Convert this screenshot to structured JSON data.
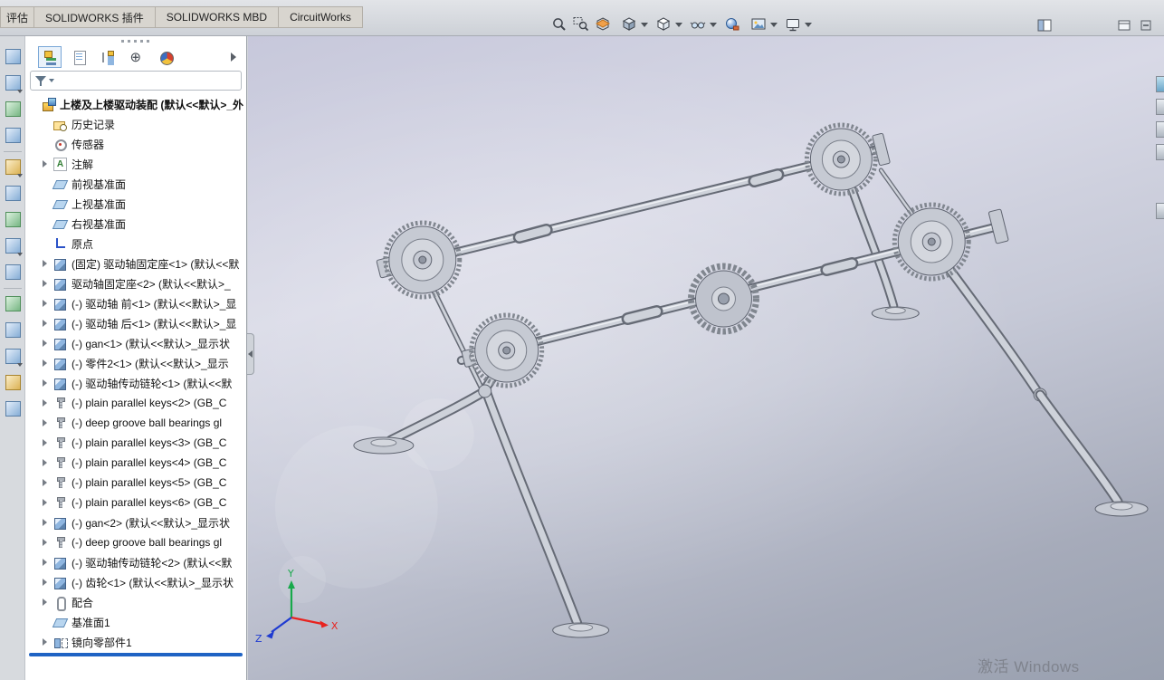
{
  "header": {
    "tabs": [
      "评估",
      "SOLIDWORKS 插件",
      "SOLIDWORKS MBD",
      "CircuitWorks"
    ]
  },
  "tree": {
    "items": [
      {
        "label": "上楼及上楼驱动装配 (默认<<默认>_外",
        "icon": "assembly",
        "indent": 0,
        "arrow": "none",
        "bold": true
      },
      {
        "label": "历史记录",
        "icon": "history",
        "indent": 1,
        "arrow": "none"
      },
      {
        "label": "传感器",
        "icon": "sensor",
        "indent": 1,
        "arrow": "none"
      },
      {
        "label": "注解",
        "icon": "annotation",
        "indent": 1,
        "arrow": "collapsed"
      },
      {
        "label": "前视基准面",
        "icon": "plane",
        "indent": 1,
        "arrow": "none"
      },
      {
        "label": "上视基准面",
        "icon": "plane",
        "indent": 1,
        "arrow": "none"
      },
      {
        "label": "右视基准面",
        "icon": "plane",
        "indent": 1,
        "arrow": "none"
      },
      {
        "label": "原点",
        "icon": "origin",
        "indent": 1,
        "arrow": "none"
      },
      {
        "label": "(固定) 驱动轴固定座<1> (默认<<默",
        "icon": "part",
        "indent": 1,
        "arrow": "collapsed"
      },
      {
        "label": "驱动轴固定座<2> (默认<<默认>_",
        "icon": "part",
        "indent": 1,
        "arrow": "collapsed"
      },
      {
        "label": "(-) 驱动轴 前<1> (默认<<默认>_显",
        "icon": "part",
        "indent": 1,
        "arrow": "collapsed"
      },
      {
        "label": "(-) 驱动轴 后<1> (默认<<默认>_显",
        "icon": "part",
        "indent": 1,
        "arrow": "collapsed"
      },
      {
        "label": "(-) gan<1> (默认<<默认>_显示状",
        "icon": "part",
        "indent": 1,
        "arrow": "collapsed"
      },
      {
        "label": "(-) 零件2<1> (默认<<默认>_显示",
        "icon": "part",
        "indent": 1,
        "arrow": "collapsed"
      },
      {
        "label": "(-) 驱动轴传动链轮<1> (默认<<默",
        "icon": "part",
        "indent": 1,
        "arrow": "collapsed"
      },
      {
        "label": "(-) plain parallel keys<2> (GB_C",
        "icon": "fastener",
        "indent": 1,
        "arrow": "collapsed"
      },
      {
        "label": "(-) deep groove ball bearings gl",
        "icon": "fastener",
        "indent": 1,
        "arrow": "collapsed"
      },
      {
        "label": "(-) plain parallel keys<3> (GB_C",
        "icon": "fastener",
        "indent": 1,
        "arrow": "collapsed"
      },
      {
        "label": "(-) plain parallel keys<4> (GB_C",
        "icon": "fastener",
        "indent": 1,
        "arrow": "collapsed"
      },
      {
        "label": "(-) plain parallel keys<5> (GB_C",
        "icon": "fastener",
        "indent": 1,
        "arrow": "collapsed"
      },
      {
        "label": "(-) plain parallel keys<6> (GB_C",
        "icon": "fastener",
        "indent": 1,
        "arrow": "collapsed"
      },
      {
        "label": "(-) gan<2> (默认<<默认>_显示状",
        "icon": "part",
        "indent": 1,
        "arrow": "collapsed"
      },
      {
        "label": "(-) deep groove ball bearings gl",
        "icon": "fastener",
        "indent": 1,
        "arrow": "collapsed"
      },
      {
        "label": "(-) 驱动轴传动链轮<2> (默认<<默",
        "icon": "part",
        "indent": 1,
        "arrow": "collapsed"
      },
      {
        "label": "(-) 齿轮<1> (默认<<默认>_显示状",
        "icon": "part",
        "indent": 1,
        "arrow": "collapsed"
      },
      {
        "label": "配合",
        "icon": "mate",
        "indent": 1,
        "arrow": "collapsed"
      },
      {
        "label": "基准面1",
        "icon": "plane",
        "indent": 1,
        "arrow": "none"
      },
      {
        "label": "镜向零部件1",
        "icon": "mirror",
        "indent": 1,
        "arrow": "collapsed"
      }
    ]
  },
  "viewport": {
    "triad": {
      "x": "X",
      "y": "Y",
      "z": "Z"
    },
    "watermark": "激活 Windows"
  },
  "colors": {
    "triad_x": "#e8231f",
    "triad_y": "#18a94b",
    "triad_z": "#1f3bd1",
    "rollback_bar": "#1f63c4",
    "viewport_top": "#c7c8db",
    "viewport_bottom": "#99a0af"
  }
}
